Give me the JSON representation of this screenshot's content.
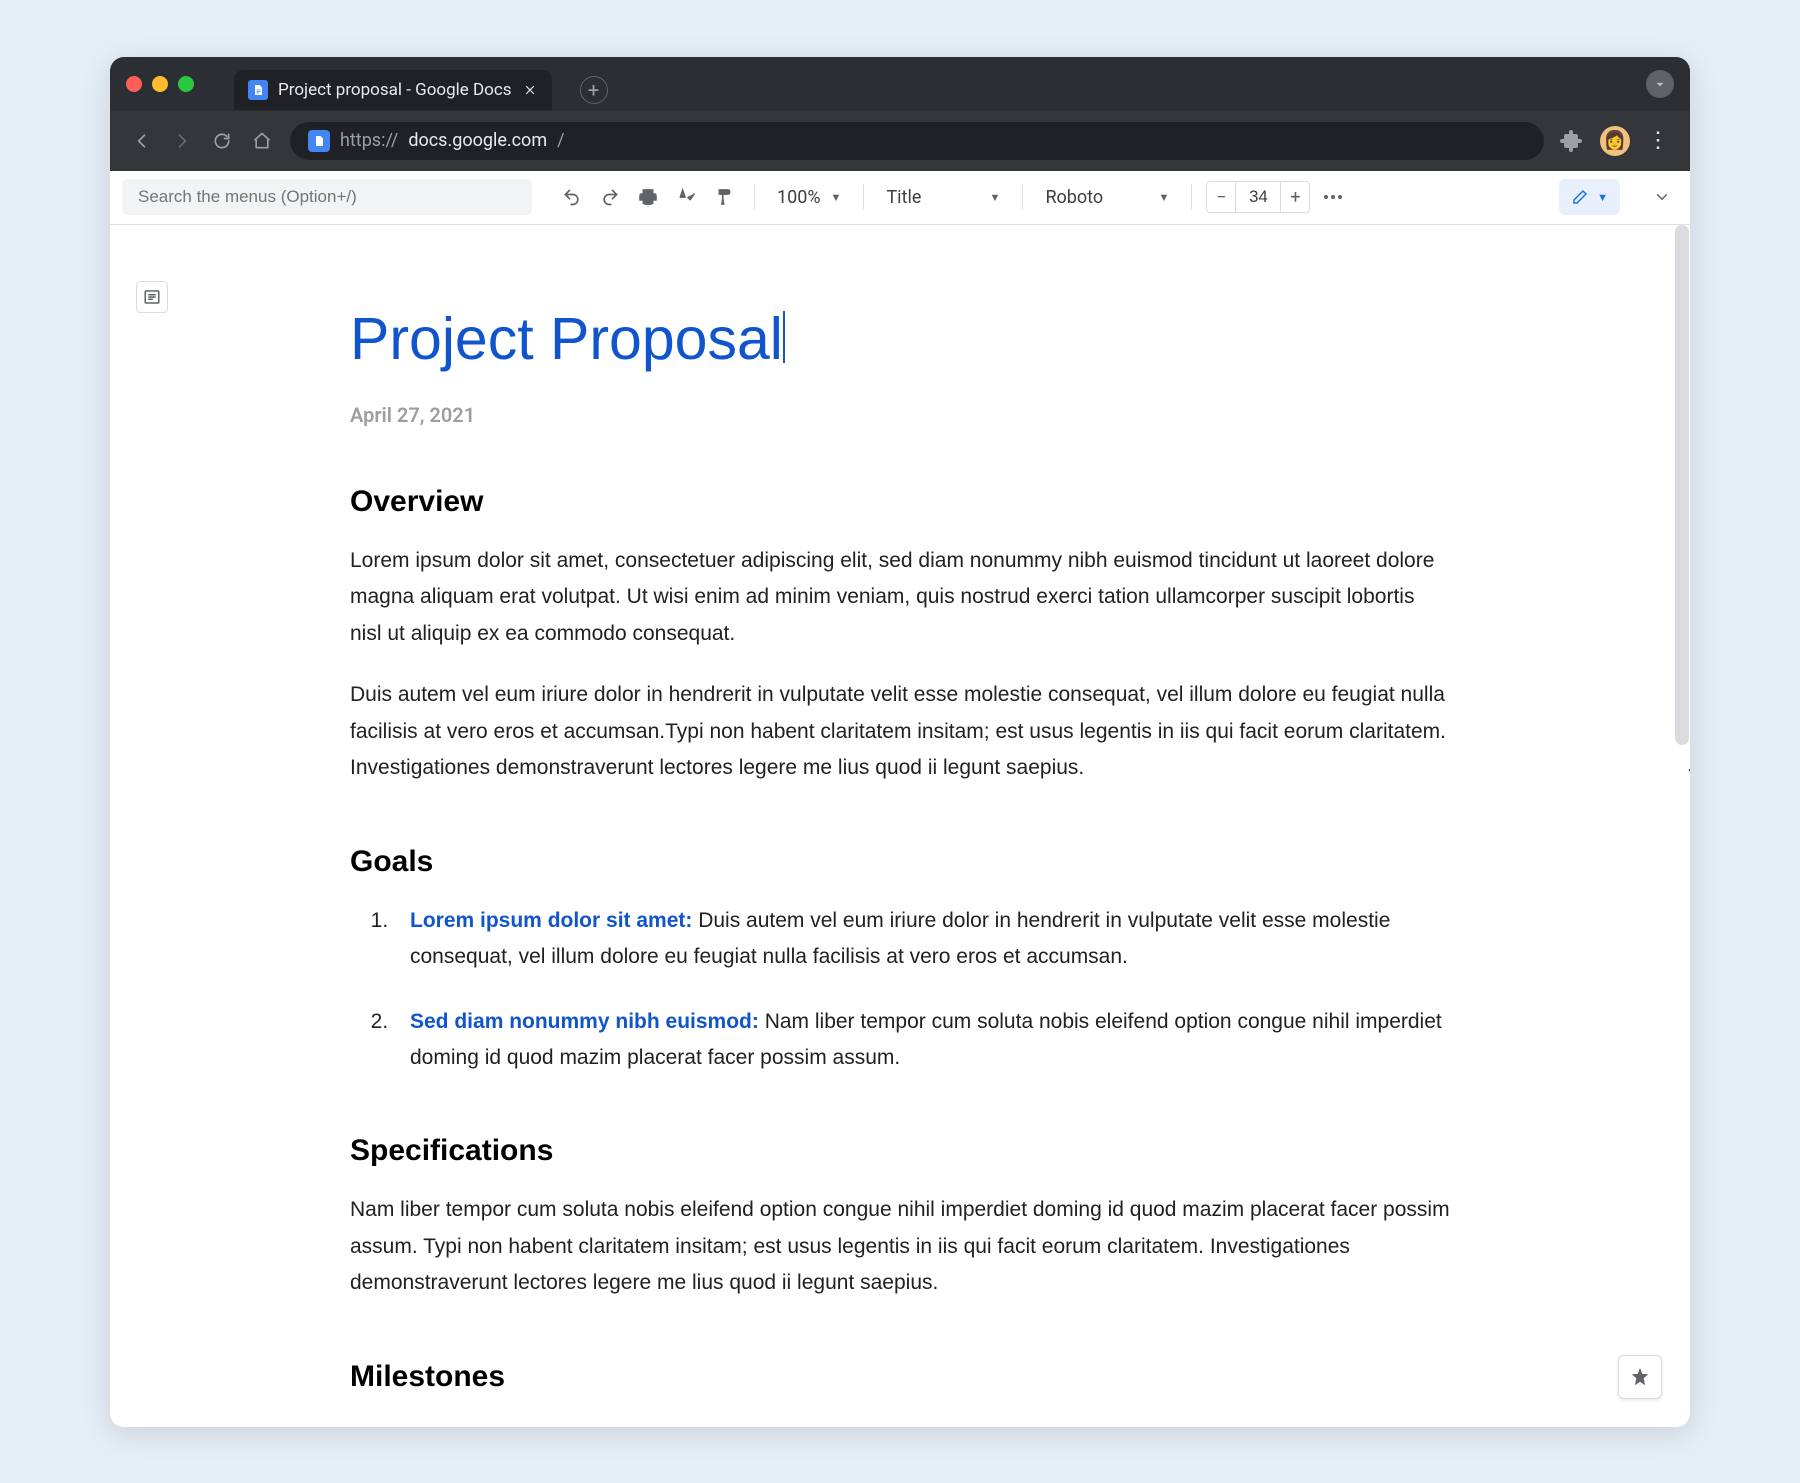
{
  "browser": {
    "tab_title": "Project proposal - Google Docs",
    "url_scheme": "https://",
    "url_host": "docs.google.com",
    "url_path": "/"
  },
  "toolbar": {
    "search_placeholder": "Search the menus (Option+/)",
    "zoom": "100%",
    "style": "Title",
    "font": "Roboto",
    "font_size": "34"
  },
  "document": {
    "title": "Project Proposal",
    "date": "April 27, 2021",
    "sections": {
      "overview": {
        "heading": "Overview",
        "p1": "Lorem ipsum dolor sit amet, consectetuer adipiscing elit, sed diam nonummy nibh euismod tincidunt ut laoreet dolore magna aliquam erat volutpat. Ut wisi enim ad minim veniam, quis nostrud exerci tation ullamcorper suscipit lobortis nisl ut aliquip ex ea commodo consequat.",
        "p2": "Duis autem vel eum iriure dolor in hendrerit in vulputate velit esse molestie consequat, vel illum dolore eu feugiat nulla facilisis at vero eros et accumsan.Typi non habent claritatem insitam; est usus legentis in iis qui facit eorum claritatem. Investigationes demonstraverunt lectores legere me lius quod ii legunt saepius."
      },
      "goals": {
        "heading": "Goals",
        "items": [
          {
            "label": "Lorem ipsum dolor sit amet:",
            "text": " Duis autem vel eum iriure dolor in hendrerit in vulputate velit esse molestie consequat, vel illum dolore eu feugiat nulla facilisis at vero eros et accumsan."
          },
          {
            "label": "Sed diam nonummy nibh euismod:",
            "text": " Nam liber tempor cum soluta nobis eleifend option congue nihil imperdiet doming id quod mazim placerat facer possim assum."
          }
        ]
      },
      "specifications": {
        "heading": "Specifications",
        "p1": "Nam liber tempor cum soluta nobis eleifend option congue nihil imperdiet doming id quod mazim placerat facer possim assum. Typi non habent claritatem insitam; est usus legentis in iis qui facit eorum claritatem. Investigationes demonstraverunt lectores legere me lius quod ii legunt saepius."
      },
      "milestones": {
        "heading": "Milestones"
      }
    }
  }
}
